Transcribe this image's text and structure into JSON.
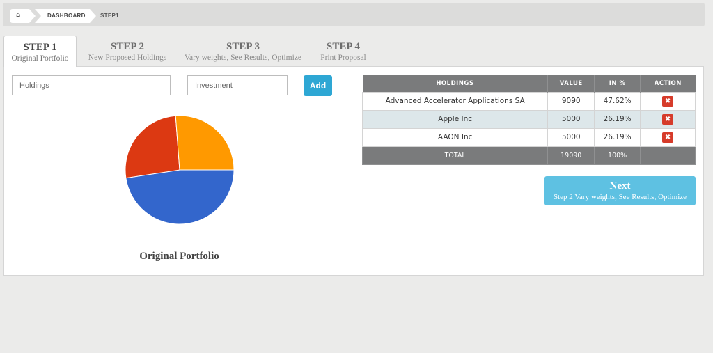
{
  "breadcrumb": {
    "home_icon": "home-icon",
    "dashboard": "DASHBOARD",
    "current": "STEP1"
  },
  "tabs": [
    {
      "title": "STEP 1",
      "subtitle": "Original Portfolio",
      "active": true
    },
    {
      "title": "STEP 2",
      "subtitle": "New Proposed Holdings",
      "active": false
    },
    {
      "title": "STEP 3",
      "subtitle": "Vary weights, See Results, Optimize",
      "active": false
    },
    {
      "title": "STEP 4",
      "subtitle": "Print Proposal",
      "active": false
    }
  ],
  "form": {
    "holdings_placeholder": "Holdings",
    "investment_placeholder": "Investment",
    "add_label": "Add"
  },
  "chart_data": {
    "type": "pie",
    "title": "Original Portfolio",
    "slices": [
      {
        "label": "Advanced Accelerator Applications SA",
        "value": 9090,
        "color": "#3366cc"
      },
      {
        "label": "Apple Inc",
        "value": 5000,
        "color": "#dc3912"
      },
      {
        "label": "AAON Inc",
        "value": 5000,
        "color": "#ff9900"
      }
    ]
  },
  "table": {
    "headers": [
      "HOLDINGS",
      "VALUE",
      "IN %",
      "ACTION"
    ],
    "rows": [
      {
        "holding": "Advanced Accelerator Applications SA",
        "value": "9090",
        "pct": "47.62%",
        "action_icon": "delete-icon"
      },
      {
        "holding": "Apple Inc",
        "value": "5000",
        "pct": "26.19%",
        "action_icon": "delete-icon"
      },
      {
        "holding": "AAON Inc",
        "value": "5000",
        "pct": "26.19%",
        "action_icon": "delete-icon"
      }
    ],
    "total": {
      "label": "TOTAL",
      "value": "19090",
      "pct": "100%"
    }
  },
  "next": {
    "title": "Next",
    "subtitle": "Step 2 Vary weights, See Results, Optimize"
  },
  "colors": {
    "accent": "#2ea7d4",
    "next_button": "#5ec1e2",
    "delete": "#d63b2a",
    "table_header": "#7a7b7c"
  }
}
